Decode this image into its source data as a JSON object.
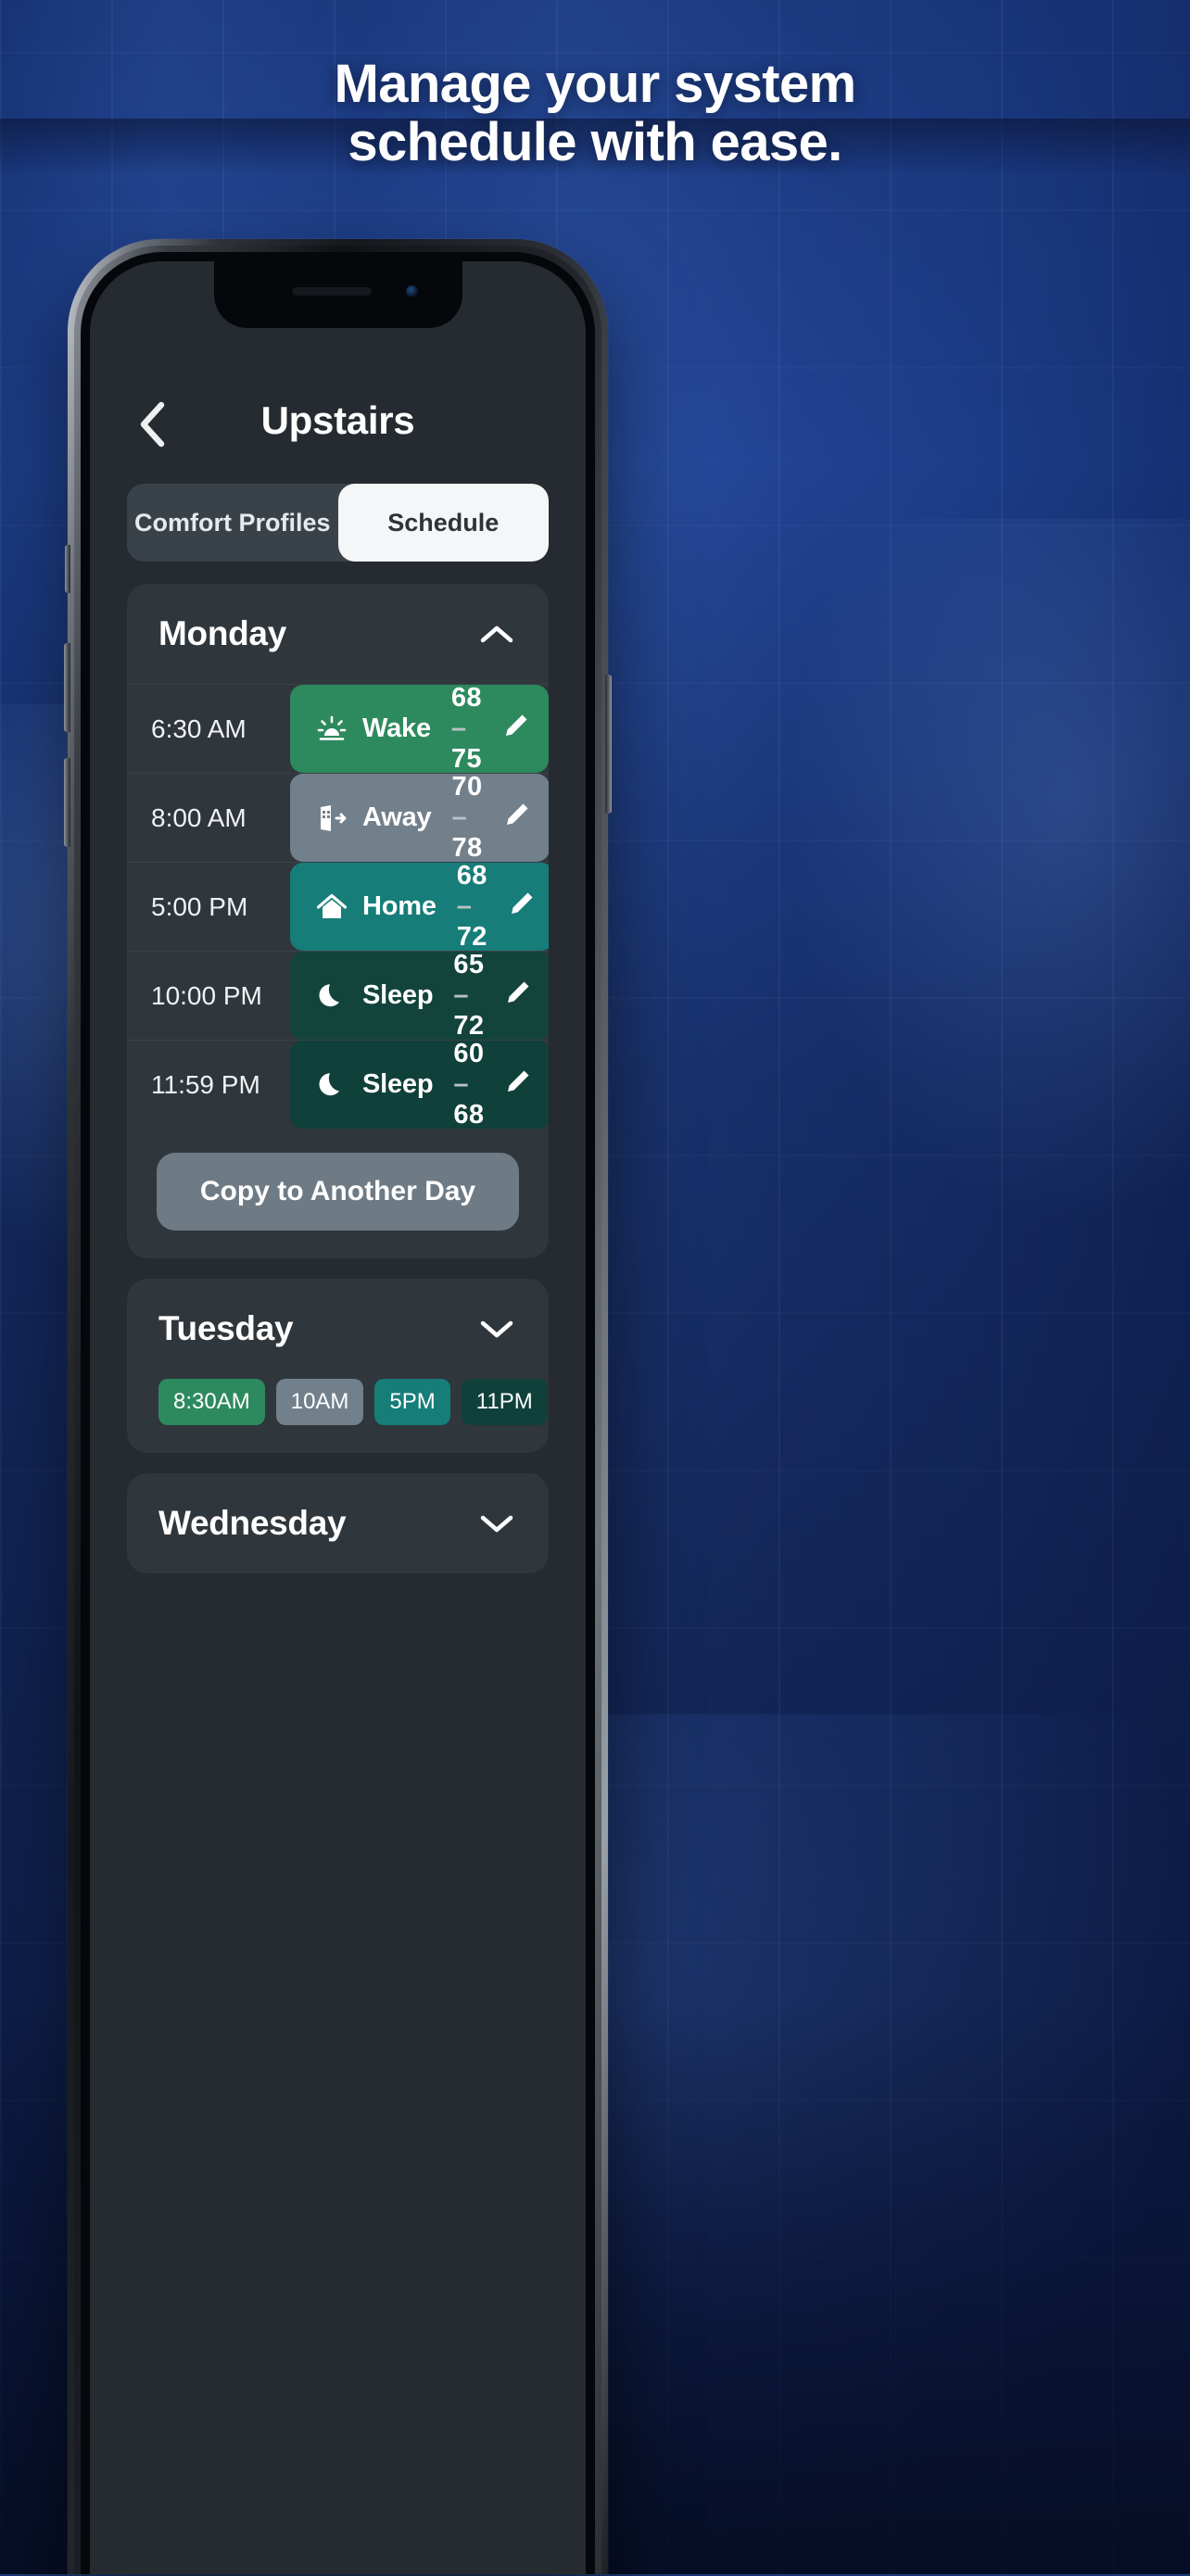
{
  "marketing": {
    "headline_line1": "Manage your system",
    "headline_line2": "schedule with ease."
  },
  "app": {
    "nav": {
      "back_icon": "chevron-left-icon",
      "title": "Upstairs"
    },
    "tabs": [
      {
        "label": "Comfort Profiles",
        "active": false
      },
      {
        "label": "Schedule",
        "active": true
      }
    ],
    "days": [
      {
        "name": "Monday",
        "expanded": true,
        "chevron": "chevron-up-icon",
        "rows": [
          {
            "time": "6:30 AM",
            "icon": "sunrise-icon",
            "label": "Wake",
            "temp_low": "68",
            "temp_high": "75",
            "color": "#2d8a5e",
            "edit_icon": "pencil-icon"
          },
          {
            "time": "8:00 AM",
            "icon": "door-exit-icon",
            "label": "Away",
            "temp_low": "70",
            "temp_high": "78",
            "color": "#72808b",
            "edit_icon": "pencil-icon"
          },
          {
            "time": "5:00 PM",
            "icon": "house-icon",
            "label": "Home",
            "temp_low": "68",
            "temp_high": "72",
            "color": "#167d78",
            "edit_icon": "pencil-icon"
          },
          {
            "time": "10:00 PM",
            "icon": "moon-icon",
            "label": "Sleep",
            "temp_low": "65",
            "temp_high": "72",
            "color": "#12443c",
            "edit_icon": "pencil-icon"
          },
          {
            "time": "11:59 PM",
            "icon": "moon-icon",
            "label": "Sleep",
            "temp_low": "60",
            "temp_high": "68",
            "color": "#0f4039",
            "edit_icon": "pencil-icon"
          }
        ],
        "copy_button": "Copy to Another Day"
      },
      {
        "name": "Tuesday",
        "expanded": false,
        "chevron": "chevron-down-icon",
        "chips": [
          {
            "label": "8:30AM",
            "color": "#2d8a5e"
          },
          {
            "label": "10AM",
            "color": "#72808b"
          },
          {
            "label": "5PM",
            "color": "#167d78"
          },
          {
            "label": "11PM",
            "color": "#0f4039"
          }
        ]
      },
      {
        "name": "Wednesday",
        "expanded": false,
        "chevron": "chevron-down-icon"
      }
    ]
  },
  "colors": {
    "screen_bg": "#252b30",
    "card_bg": "#2f363c",
    "seg_bg": "#3a4249",
    "seg_active_bg": "#f5f6f7",
    "accent_green": "#2d8a5e",
    "accent_gray": "#72808b",
    "accent_teal": "#167d78",
    "accent_dark_teal": "#0f4039",
    "brand_blue": "#2a53a8"
  }
}
